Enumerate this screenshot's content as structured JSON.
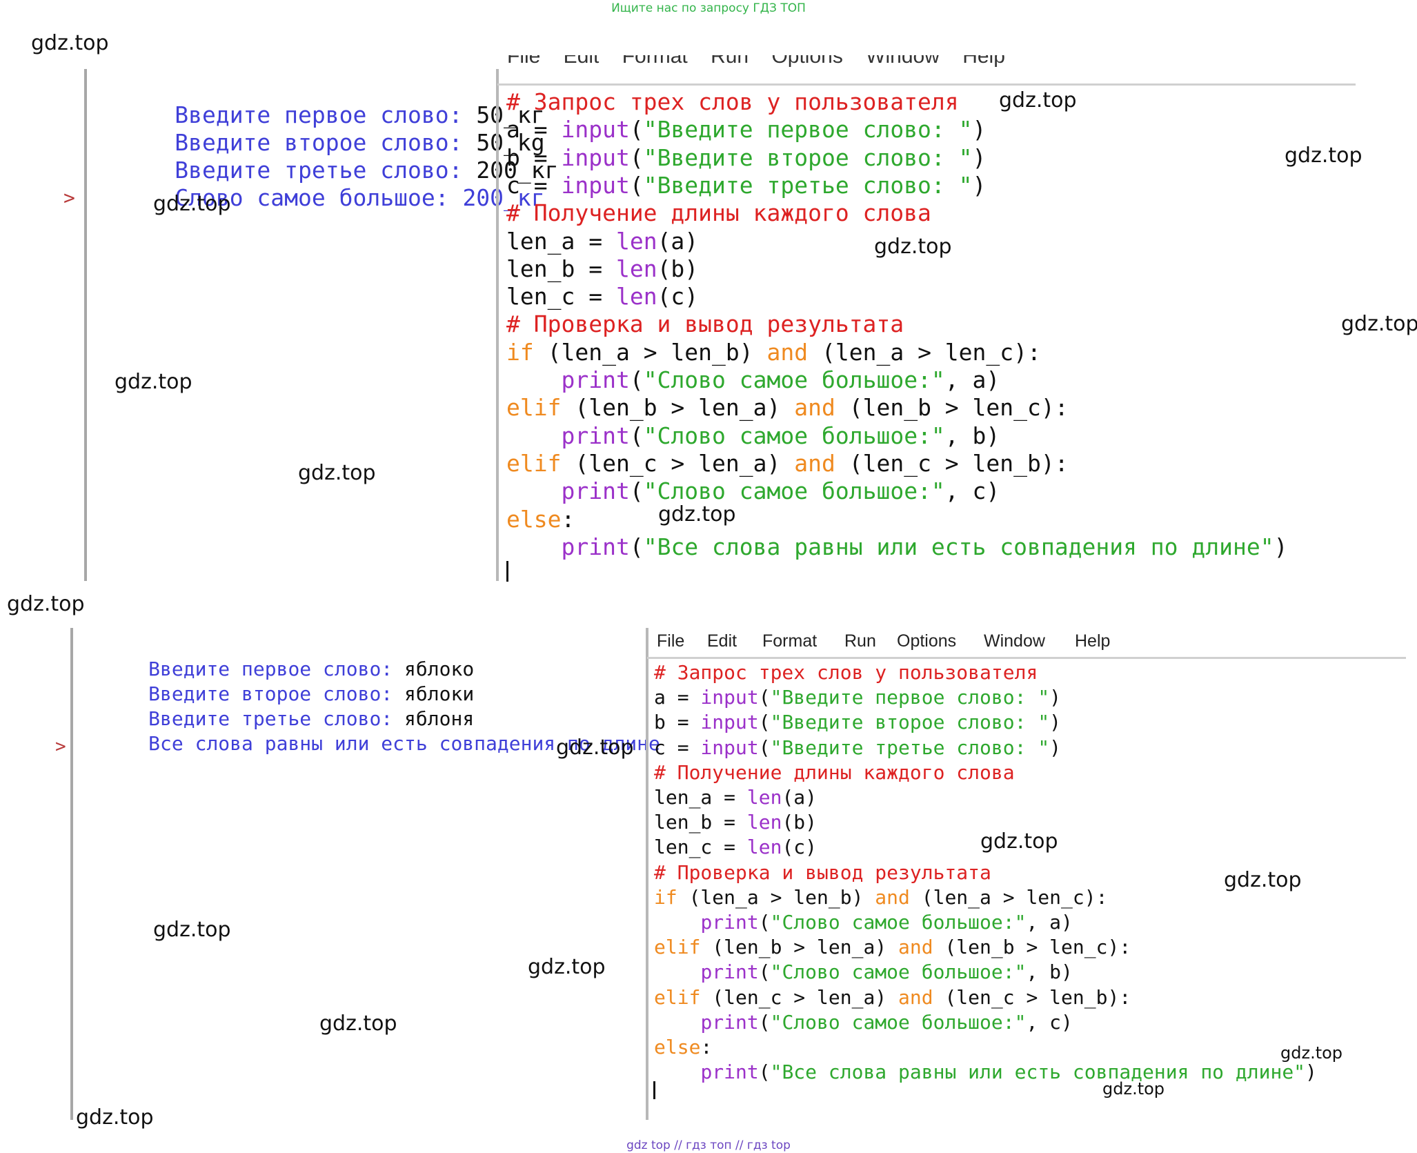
{
  "top_note": "Ищите нас по запросу ГДЗ ТОП",
  "bottom_note": "gdz top  //  гдз топ  //  гдз top",
  "watermark": "gdz.top",
  "shell_prompt": ">",
  "panel1": {
    "menu_partial": "File    Edit    Format    Run    Options    Window    Help",
    "shell": [
      {
        "label": "Введите первое слово: ",
        "value": "50_кг"
      },
      {
        "label": "Введите второе слово: ",
        "value": "50_kg"
      },
      {
        "label": "Введите третье слово: ",
        "value": "200_кг"
      },
      {
        "label": "Слово самое большое: 200_кг",
        "value": ""
      }
    ]
  },
  "panel2": {
    "menu": [
      "File",
      "Edit",
      "Format",
      "Run",
      "Options",
      "Window",
      "Help"
    ],
    "shell": [
      {
        "label": "Введите первое слово: ",
        "value": "яблоко"
      },
      {
        "label": "Введите второе слово: ",
        "value": "яблоки"
      },
      {
        "label": "Введите третье слово: ",
        "value": "яблоня"
      },
      {
        "label": "Все слова равны или есть совпадения по длине",
        "value": ""
      }
    ]
  },
  "code": [
    [
      [
        "c-comment",
        "# Запрос трех слов у пользователя"
      ]
    ],
    [
      [
        "c-plain",
        "a = "
      ],
      [
        "c-builtin",
        "input"
      ],
      [
        "c-plain",
        "("
      ],
      [
        "c-string",
        "\"Введите первое слово: \""
      ],
      [
        "c-plain",
        ")"
      ]
    ],
    [
      [
        "c-plain",
        "b = "
      ],
      [
        "c-builtin",
        "input"
      ],
      [
        "c-plain",
        "("
      ],
      [
        "c-string",
        "\"Введите второе слово: \""
      ],
      [
        "c-plain",
        ")"
      ]
    ],
    [
      [
        "c-plain",
        "c = "
      ],
      [
        "c-builtin",
        "input"
      ],
      [
        "c-plain",
        "("
      ],
      [
        "c-string",
        "\"Введите третье слово: \""
      ],
      [
        "c-plain",
        ")"
      ]
    ],
    [
      [
        "c-comment",
        "# Получение длины каждого слова"
      ]
    ],
    [
      [
        "c-plain",
        "len_a = "
      ],
      [
        "c-builtin",
        "len"
      ],
      [
        "c-plain",
        "(a)"
      ]
    ],
    [
      [
        "c-plain",
        "len_b = "
      ],
      [
        "c-builtin",
        "len"
      ],
      [
        "c-plain",
        "(b)"
      ]
    ],
    [
      [
        "c-plain",
        "len_c = "
      ],
      [
        "c-builtin",
        "len"
      ],
      [
        "c-plain",
        "(c)"
      ]
    ],
    [
      [
        "c-comment",
        "# Проверка и вывод результата"
      ]
    ],
    [
      [
        "c-keyword",
        "if"
      ],
      [
        "c-plain",
        " (len_a > len_b) "
      ],
      [
        "c-keyword",
        "and"
      ],
      [
        "c-plain",
        " (len_a > len_c):"
      ]
    ],
    [
      [
        "c-plain",
        "    "
      ],
      [
        "c-builtin",
        "print"
      ],
      [
        "c-plain",
        "("
      ],
      [
        "c-string",
        "\"Слово самое большое:\""
      ],
      [
        "c-plain",
        ", a)"
      ]
    ],
    [
      [
        "c-keyword",
        "elif"
      ],
      [
        "c-plain",
        " (len_b > len_a) "
      ],
      [
        "c-keyword",
        "and"
      ],
      [
        "c-plain",
        " (len_b > len_c):"
      ]
    ],
    [
      [
        "c-plain",
        "    "
      ],
      [
        "c-builtin",
        "print"
      ],
      [
        "c-plain",
        "("
      ],
      [
        "c-string",
        "\"Слово самое большое:\""
      ],
      [
        "c-plain",
        ", b)"
      ]
    ],
    [
      [
        "c-keyword",
        "elif"
      ],
      [
        "c-plain",
        " (len_c > len_a) "
      ],
      [
        "c-keyword",
        "and"
      ],
      [
        "c-plain",
        " (len_c > len_b):"
      ]
    ],
    [
      [
        "c-plain",
        "    "
      ],
      [
        "c-builtin",
        "print"
      ],
      [
        "c-plain",
        "("
      ],
      [
        "c-string",
        "\"Слово самое большое:\""
      ],
      [
        "c-plain",
        ", c)"
      ]
    ],
    [
      [
        "c-keyword",
        "else"
      ],
      [
        "c-plain",
        ":"
      ]
    ],
    [
      [
        "c-plain",
        "    "
      ],
      [
        "c-builtin",
        "print"
      ],
      [
        "c-plain",
        "("
      ],
      [
        "c-string",
        "\"Все слова равны или есть совпадения по длине\""
      ],
      [
        "c-plain",
        ")"
      ]
    ]
  ]
}
